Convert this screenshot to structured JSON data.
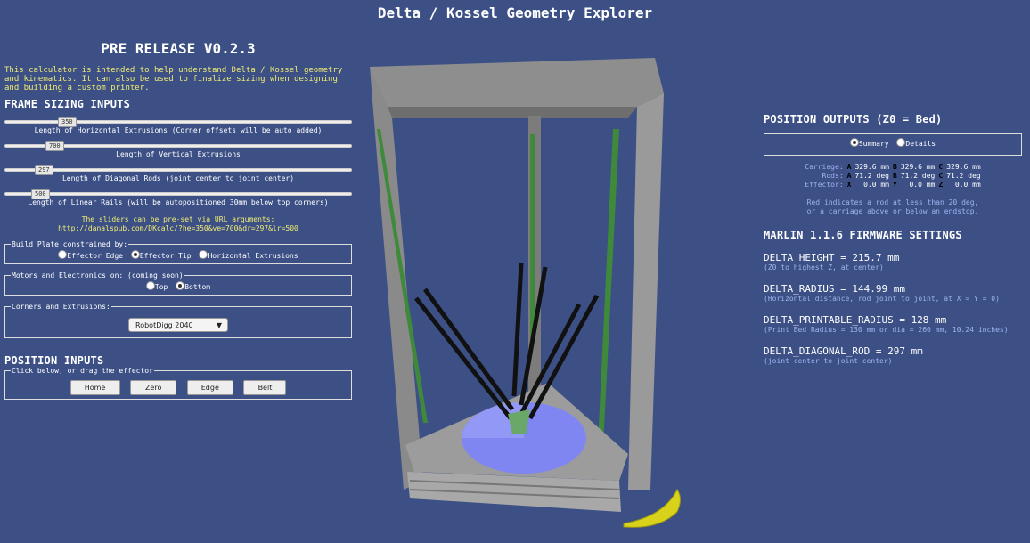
{
  "app": {
    "title": "Delta / Kossel Geometry Explorer"
  },
  "left": {
    "release": "PRE RELEASE V0.2.3",
    "intro": "This calculator is intended to help understand Delta / Kossel geometry and kinematics. It can also be used to finalize sizing when designing and building a custom printer.",
    "frame_heading": "FRAME SIZING INPUTS",
    "sliders": [
      {
        "value": "350",
        "fraction": 0.19,
        "label": "Length of Horizontal Extrusions (Corner offsets will be auto added)"
      },
      {
        "value": "700",
        "fraction": 0.14,
        "label": "Length of Vertical Extrusions"
      },
      {
        "value": "297",
        "fraction": 0.11,
        "label": "Length of Diagonal Rods (joint center to joint center)"
      },
      {
        "value": "500",
        "fraction": 0.09,
        "label": "Length of Linear Rails (will be autopositioned 30mm below top corners)"
      }
    ],
    "url_note_1": "The sliders can be pre-set via URL arguments:",
    "url_note_2": "http://danalspub.com/DKcalc/?he=350&ve=700&dr=297&lr=500",
    "build_plate": {
      "legend": "Build Plate constrained by:",
      "options": [
        "Effector Edge",
        "Effector Tip",
        "Horizontal Extrusions"
      ],
      "selected": 1
    },
    "motors": {
      "legend": "Motors and Electronics on: (coming soon)",
      "options": [
        "Top",
        "Bottom"
      ],
      "selected": 1
    },
    "corners": {
      "legend": "Corners and Extrusions:",
      "selected": "RobotDigg 2040"
    },
    "position_heading": "POSITION INPUTS",
    "position_legend": "Click below, or drag the effector",
    "buttons": [
      "Home",
      "Zero",
      "Edge",
      "Belt"
    ]
  },
  "right": {
    "outputs_heading": "POSITION OUTPUTS (Z0 = Bed)",
    "view_options": [
      "Summary",
      "Details"
    ],
    "view_selected": 0,
    "readout": [
      {
        "label": "Carriage:",
        "cells": [
          [
            "A",
            "329.6 mm"
          ],
          [
            "B",
            "329.6 mm"
          ],
          [
            "C",
            "329.6 mm"
          ]
        ]
      },
      {
        "label": "Rods:",
        "cells": [
          [
            "A",
            "71.2 deg"
          ],
          [
            "B",
            "71.2 deg"
          ],
          [
            "C",
            "71.2 deg"
          ]
        ]
      },
      {
        "label": "Effector:",
        "cells": [
          [
            "X",
            "0.0 mm"
          ],
          [
            "Y",
            "0.0 mm"
          ],
          [
            "Z",
            "0.0 mm"
          ]
        ]
      }
    ],
    "red_note_1": "Red indicates a rod at less than 20 deg,",
    "red_note_2": "or a carriage above or below an endstop.",
    "firmware_heading": "MARLIN 1.1.6 FIRMWARE SETTINGS",
    "firmware": [
      {
        "line": "DELTA_HEIGHT = 215.7 mm",
        "desc": "(Z0 to highest Z, at center)"
      },
      {
        "line": "DELTA_RADIUS = 144.99 mm",
        "desc": "(Horizontal distance, rod joint to joint, at X = Y = 0)"
      },
      {
        "line": "DELTA_PRINTABLE_RADIUS = 128 mm",
        "desc": "(Print Bed Radius = 130 mm or dia = 260 mm, 10.24 inches)"
      },
      {
        "line": "DELTA_DIAGONAL_ROD = 297 mm",
        "desc": "(joint center to joint center)"
      }
    ]
  },
  "colors": {
    "background": "#3c5086",
    "yellow_text": "#f2ec72",
    "muted_text": "#9fb4f0",
    "frame_gray": "#8e8e8e",
    "rail_green": "#3f8a3a",
    "bed_blue": "#7f86f2",
    "banana_yellow": "#d8d21a"
  }
}
